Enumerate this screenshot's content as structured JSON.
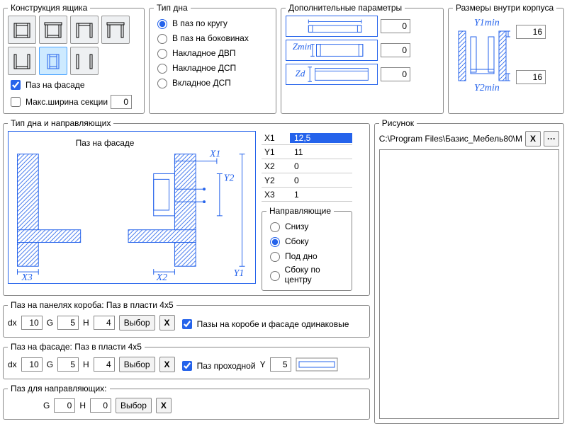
{
  "group_construction": {
    "title": "Конструкция ящика",
    "paz_fasade": "Паз на фасаде",
    "max_width_section": "Макс.ширина секции",
    "max_width_value": "0"
  },
  "group_bottom_type": {
    "title": "Тип дна",
    "options": [
      "В паз по кругу",
      "В паз на боковинах",
      "Накладное ДВП",
      "Накладное ДСП",
      "Вкладное ДСП"
    ],
    "selected": 0
  },
  "group_extra": {
    "title": "Дополнительные параметры",
    "params": {
      "X": "0",
      "Zmin": "0",
      "Zd": "0"
    }
  },
  "group_body": {
    "title": "Размеры внутри корпуса",
    "y1min": "16",
    "y2min": "16"
  },
  "group_typeguides": {
    "title": "Тип дна и направляющих",
    "diagram_title": "Паз на фасаде",
    "values": {
      "X1": "12,5",
      "Y1": "11",
      "X2": "0",
      "Y2": "0",
      "X3": "1"
    },
    "guides_title": "Направляющие",
    "guides_options": [
      "Снизу",
      "Сбоку",
      "Под дно",
      "Сбоку по центру"
    ],
    "guides_selected": 1
  },
  "group_paz_panels": {
    "title_prefix": "Паз на панелях короба: ",
    "title_suffix": "Паз в пласти 4x5",
    "dx": "10",
    "G": "5",
    "H": "4",
    "choose": "Выбор",
    "same_label": "Пазы на коробе и фасаде одинаковые"
  },
  "group_paz_fasade": {
    "title_prefix": "Паз на фасаде: ",
    "title_suffix": "Паз в пласти 4x5",
    "dx": "10",
    "G": "5",
    "H": "4",
    "choose": "Выбор",
    "through_label": "Паз проходной",
    "Y": "5"
  },
  "group_paz_guides": {
    "title": "Паз для направляющих:",
    "G": "0",
    "H": "0",
    "choose": "Выбор"
  },
  "group_picture": {
    "title": "Рисунок",
    "path": "C:\\Program Files\\Базис_Мебель80\\М"
  },
  "labels": {
    "dx": "dx",
    "G": "G",
    "H": "H",
    "Y": "Y",
    "X": "X",
    "dots": "···"
  },
  "diagram_labels": {
    "X1": "X1",
    "X2": "X2",
    "X3": "X3",
    "Y1": "Y1",
    "Y2": "Y2",
    "Y1min": "Y1min",
    "Y2min": "Y2min",
    "Zmin": "Zmin",
    "Zd": "Zd"
  }
}
